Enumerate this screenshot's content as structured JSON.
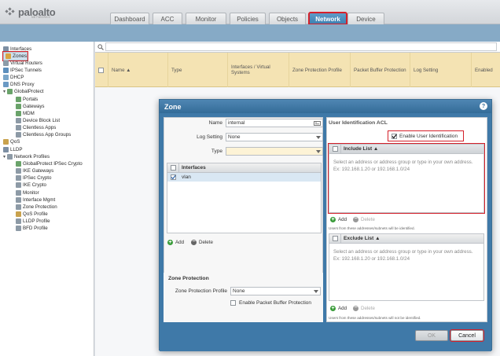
{
  "brand": {
    "name": "paloalto",
    "tagline": "NETWORKS"
  },
  "tabs": [
    "Dashboard",
    "ACC",
    "Monitor",
    "Policies",
    "Objects",
    "Network",
    "Device"
  ],
  "active_tab": "Network",
  "sidebar": [
    {
      "label": "Interfaces",
      "indent": 0,
      "color": "#7d8fa3"
    },
    {
      "label": "Zones",
      "indent": 0,
      "color": "#d9a441",
      "selected": true
    },
    {
      "label": "Virtual Routers",
      "indent": 0,
      "color": "#8c9ca9"
    },
    {
      "label": "IPSec Tunnels",
      "indent": 0,
      "color": "#5c8fbd"
    },
    {
      "label": "DHCP",
      "indent": 0,
      "color": "#7aa6c9"
    },
    {
      "label": "DNS Proxy",
      "indent": 0,
      "color": "#6b9ac4"
    },
    {
      "label": "GlobalProtect",
      "indent": 0,
      "color": "#6aa36a"
    },
    {
      "label": "Portals",
      "indent": 1,
      "color": "#6aa36a"
    },
    {
      "label": "Gateways",
      "indent": 1,
      "color": "#6aa36a"
    },
    {
      "label": "MDM",
      "indent": 1,
      "color": "#6aa36a"
    },
    {
      "label": "Device Block List",
      "indent": 1,
      "color": "#8d9aa6"
    },
    {
      "label": "Clientless Apps",
      "indent": 1,
      "color": "#8d9aa6"
    },
    {
      "label": "Clientless App Groups",
      "indent": 1,
      "color": "#8d9aa6"
    },
    {
      "label": "QoS",
      "indent": 0,
      "color": "#c9a24d"
    },
    {
      "label": "LLDP",
      "indent": 0,
      "color": "#7d8fa3"
    },
    {
      "label": "Network Profiles",
      "indent": 0,
      "color": "#8d9aa6"
    },
    {
      "label": "GlobalProtect IPSec Crypto",
      "indent": 1,
      "color": "#6aa36a"
    },
    {
      "label": "IKE Gateways",
      "indent": 1,
      "color": "#8d9aa6"
    },
    {
      "label": "IPSec Crypto",
      "indent": 1,
      "color": "#8d9aa6"
    },
    {
      "label": "IKE Crypto",
      "indent": 1,
      "color": "#8d9aa6"
    },
    {
      "label": "Monitor",
      "indent": 1,
      "color": "#8d9aa6"
    },
    {
      "label": "Interface Mgmt",
      "indent": 1,
      "color": "#8d9aa6"
    },
    {
      "label": "Zone Protection",
      "indent": 1,
      "color": "#8d9aa6"
    },
    {
      "label": "QoS Profile",
      "indent": 1,
      "color": "#c9a24d"
    },
    {
      "label": "LLDP Profile",
      "indent": 1,
      "color": "#8d9aa6"
    },
    {
      "label": "BFD Profile",
      "indent": 1,
      "color": "#8d9aa6"
    }
  ],
  "grid_columns": [
    "Name ▲",
    "Type",
    "Interfaces / Virtual Systems",
    "Zone Protection Profile",
    "Packet Buffer Protection",
    "Log Setting",
    "Enabled"
  ],
  "modal": {
    "title": "Zone",
    "help": "?",
    "name_label": "Name",
    "name_value": "internal",
    "log_setting_label": "Log Setting",
    "log_setting_value": "None",
    "type_label": "Type",
    "type_value": "",
    "interfaces_header": "Interfaces",
    "interfaces": [
      "vlan"
    ],
    "add_label": "Add",
    "delete_label": "Delete",
    "zone_protection_title": "Zone Protection",
    "zone_protection_profile_label": "Zone Protection Profile",
    "zone_protection_profile_value": "None",
    "packet_buffer_label": "Enable Packet Buffer Protection",
    "user_id_acl_title": "User Identification ACL",
    "enable_user_id_label": "Enable User Identification",
    "include_list_header": "Include List ▲",
    "include_placeholder": "Select an address or address group or type in your own address. Ex: 192.168.1.20 or 192.168.1.0/24",
    "include_hint": "Users from these addresses/subnets will be identified.",
    "exclude_list_header": "Exclude List ▲",
    "exclude_placeholder": "Select an address or address group or type in your own address. Ex: 192.168.1.20 or 192.168.1.0/24",
    "exclude_hint": "Users from these addresses/subnets will not be identified.",
    "ok_label": "OK",
    "cancel_label": "Cancel"
  }
}
